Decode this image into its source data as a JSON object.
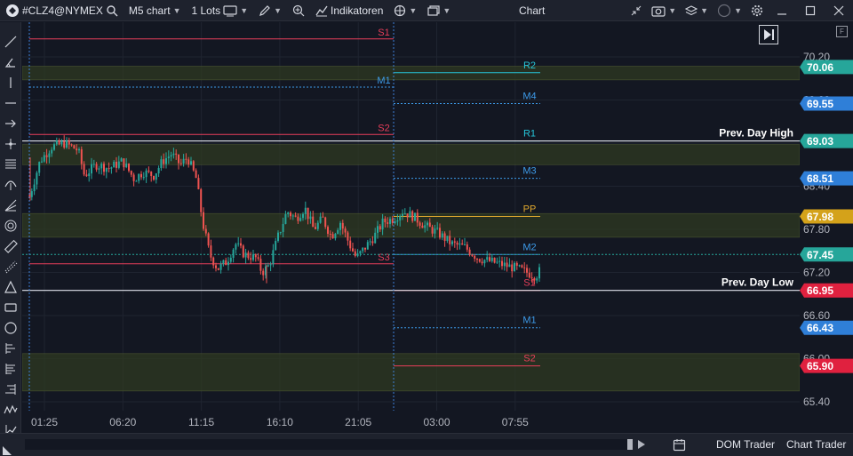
{
  "toolbar": {
    "symbol": "#CLZ4@NYMEX",
    "timeframe": "M5 chart",
    "lots": "1 Lots",
    "indicators": "Indikatoren",
    "title": "Chart"
  },
  "chart": {
    "price_ticks": [
      "70.20",
      "69.60",
      "69.00",
      "68.40",
      "67.80",
      "67.20",
      "66.60",
      "66.00",
      "65.40"
    ],
    "time_ticks": [
      "01:25",
      "06:20",
      "11:15",
      "16:10",
      "21:05",
      "03:00",
      "07:55"
    ],
    "levels_left": [
      {
        "name": "S1",
        "price": 70.45,
        "color": "#e83e5a"
      },
      {
        "name": "M1",
        "price": 69.78,
        "color": "#3d9be9"
      },
      {
        "name": "S2",
        "price": 69.12,
        "color": "#e83e5a"
      },
      {
        "name": "S3",
        "price": 67.32,
        "color": "#e83e5a"
      }
    ],
    "levels_right": [
      {
        "name": "R2",
        "price": 69.98,
        "color": "#26c6da"
      },
      {
        "name": "M4",
        "price": 69.55,
        "color": "#3d9be9"
      },
      {
        "name": "R1",
        "price": 69.03,
        "color": "#26c6da"
      },
      {
        "name": "M3",
        "price": 68.51,
        "color": "#3d9be9"
      },
      {
        "name": "PP",
        "price": 67.98,
        "color": "#e0a82e"
      },
      {
        "name": "M2",
        "price": 67.45,
        "color": "#3d9be9"
      },
      {
        "name": "S1",
        "price": 66.95,
        "color": "#e83e5a"
      },
      {
        "name": "M1",
        "price": 66.43,
        "color": "#3d9be9"
      },
      {
        "name": "S2",
        "price": 65.9,
        "color": "#e83e5a"
      }
    ],
    "prev_day_high": {
      "label": "Prev. Day High",
      "price": 69.03
    },
    "prev_day_low": {
      "label": "Prev. Day Low",
      "price": 66.95
    },
    "badges": [
      {
        "value": "70.06",
        "price": 70.06,
        "color": "#26a69a"
      },
      {
        "value": "69.55",
        "price": 69.55,
        "color": "#2f7fd8"
      },
      {
        "value": "69.03",
        "price": 69.03,
        "color": "#26a69a"
      },
      {
        "value": "68.51",
        "price": 68.51,
        "color": "#2f7fd8"
      },
      {
        "value": "67.98",
        "price": 67.98,
        "color": "#d4a21a"
      },
      {
        "value": "67.45",
        "price": 67.45,
        "color": "#26a69a"
      },
      {
        "value": "66.95",
        "price": 66.95,
        "color": "#e0213f"
      },
      {
        "value": "66.43",
        "price": 66.43,
        "color": "#2f7fd8"
      },
      {
        "value": "65.90",
        "price": 65.9,
        "color": "#e0213f"
      }
    ],
    "zones": [
      [
        70.07,
        69.88
      ],
      [
        68.98,
        68.7
      ],
      [
        68.02,
        67.69
      ],
      [
        66.07,
        65.55
      ]
    ],
    "colors": {
      "up": "#26a69a",
      "down": "#ef5350",
      "zone": "#2f3a22"
    }
  },
  "bottom": {
    "dom_trader": "DOM Trader",
    "chart_trader": "Chart Trader"
  }
}
